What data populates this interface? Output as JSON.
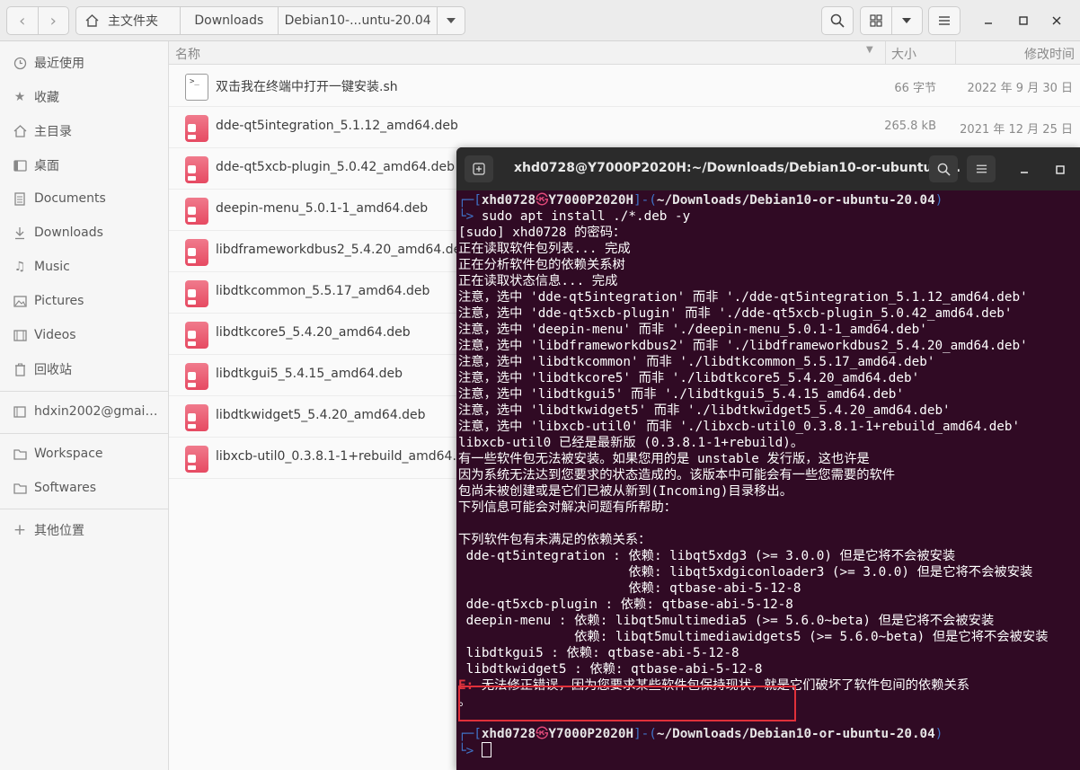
{
  "header": {
    "breadcrumbs": [
      "主文件夹",
      "Downloads",
      "Debian10-...untu-20.04"
    ]
  },
  "sidebar": {
    "items": [
      {
        "label": "最近使用",
        "icon": "clock-icon"
      },
      {
        "label": "收藏",
        "icon": "star-icon"
      },
      {
        "label": "主目录",
        "icon": "home-icon"
      },
      {
        "label": "桌面",
        "icon": "desktop-icon"
      },
      {
        "label": "Documents",
        "icon": "document-icon"
      },
      {
        "label": "Downloads",
        "icon": "download-icon"
      },
      {
        "label": "Music",
        "icon": "music-icon"
      },
      {
        "label": "Pictures",
        "icon": "picture-icon"
      },
      {
        "label": "Videos",
        "icon": "video-icon"
      },
      {
        "label": "回收站",
        "icon": "trash-icon"
      }
    ],
    "account": {
      "label": "hdxin2002@gmail...",
      "icon": "account-icon"
    },
    "bookmarks": [
      {
        "label": "Workspace",
        "icon": "folder-icon"
      },
      {
        "label": "Softwares",
        "icon": "folder-icon"
      }
    ],
    "other": {
      "label": "其他位置",
      "icon": "plus-icon"
    }
  },
  "filelist": {
    "headers": {
      "name": "名称",
      "size": "大小",
      "modified": "修改时间"
    },
    "rows": [
      {
        "name": "双击我在终端中打开一键安装.sh",
        "size": "66 字节",
        "modified": "2022 年 9 月 30 日",
        "type": "script"
      },
      {
        "name": "dde-qt5integration_5.1.12_amd64.deb",
        "size": "265.8 kB",
        "modified": "2021 年 12 月 25 日",
        "type": "deb"
      },
      {
        "name": "dde-qt5xcb-plugin_5.0.42_amd64.deb",
        "size": "",
        "modified": "",
        "type": "deb"
      },
      {
        "name": "deepin-menu_5.0.1-1_amd64.deb",
        "size": "",
        "modified": "",
        "type": "deb"
      },
      {
        "name": "libdframeworkdbus2_5.4.20_amd64.deb",
        "size": "",
        "modified": "",
        "type": "deb"
      },
      {
        "name": "libdtkcommon_5.5.17_amd64.deb",
        "size": "",
        "modified": "",
        "type": "deb"
      },
      {
        "name": "libdtkcore5_5.4.20_amd64.deb",
        "size": "",
        "modified": "",
        "type": "deb"
      },
      {
        "name": "libdtkgui5_5.4.15_amd64.deb",
        "size": "",
        "modified": "",
        "type": "deb"
      },
      {
        "name": "libdtkwidget5_5.4.20_amd64.deb",
        "size": "",
        "modified": "",
        "type": "deb"
      },
      {
        "name": "libxcb-util0_0.3.8.1-1+rebuild_amd64.deb",
        "size": "",
        "modified": "",
        "type": "deb"
      }
    ]
  },
  "terminal": {
    "title": "xhd0728@Y7000P2020H:~/Downloads/Debian10-or-ubuntu-2...",
    "prompt": {
      "user": "xhd0728",
      "host": "Y7000P2020H",
      "cwd": "~/Downloads/Debian10-or-ubuntu-20.04",
      "command": "sudo apt install ./*.deb -y"
    },
    "output_lines": [
      "[sudo] xhd0728 的密码：",
      "正在读取软件包列表... 完成",
      "正在分析软件包的依赖关系树",
      "正在读取状态信息... 完成",
      "注意，选中 'dde-qt5integration' 而非 './dde-qt5integration_5.1.12_amd64.deb'",
      "注意，选中 'dde-qt5xcb-plugin' 而非 './dde-qt5xcb-plugin_5.0.42_amd64.deb'",
      "注意，选中 'deepin-menu' 而非 './deepin-menu_5.0.1-1_amd64.deb'",
      "注意，选中 'libdframeworkdbus2' 而非 './libdframeworkdbus2_5.4.20_amd64.deb'",
      "注意，选中 'libdtkcommon' 而非 './libdtkcommon_5.5.17_amd64.deb'",
      "注意，选中 'libdtkcore5' 而非 './libdtkcore5_5.4.20_amd64.deb'",
      "注意，选中 'libdtkgui5' 而非 './libdtkgui5_5.4.15_amd64.deb'",
      "注意，选中 'libdtkwidget5' 而非 './libdtkwidget5_5.4.20_amd64.deb'",
      "注意，选中 'libxcb-util0' 而非 './libxcb-util0_0.3.8.1-1+rebuild_amd64.deb'",
      "libxcb-util0 已经是最新版 (0.3.8.1-1+rebuild)。",
      "有一些软件包无法被安装。如果您用的是 unstable 发行版，这也许是",
      "因为系统无法达到您要求的状态造成的。该版本中可能会有一些您需要的软件",
      "包尚未被创建或是它们已被从新到(Incoming)目录移出。",
      "下列信息可能会对解决问题有所帮助：",
      "",
      "下列软件包有未满足的依赖关系：",
      " dde-qt5integration : 依赖: libqt5xdg3 (>= 3.0.0) 但是它将不会被安装",
      "                      依赖: libqt5xdgiconloader3 (>= 3.0.0) 但是它将不会被安装",
      "                      依赖: qtbase-abi-5-12-8",
      " dde-qt5xcb-plugin : 依赖: qtbase-abi-5-12-8",
      " deepin-menu : 依赖: libqt5multimedia5 (>= 5.6.0~beta) 但是它将不会被安装",
      "               依赖: libqt5multimediawidgets5 (>= 5.6.0~beta) 但是它将不会被安装",
      " libdtkgui5 : 依赖: qtbase-abi-5-12-8",
      " libdtkwidget5 : 依赖: qtbase-abi-5-12-8"
    ],
    "error_prefix": "E:",
    "error_text": " 无法修正错误，因为您要求某些软件包保持现状，就是它们破坏了软件包间的依赖关系",
    "error_tail": "。"
  }
}
